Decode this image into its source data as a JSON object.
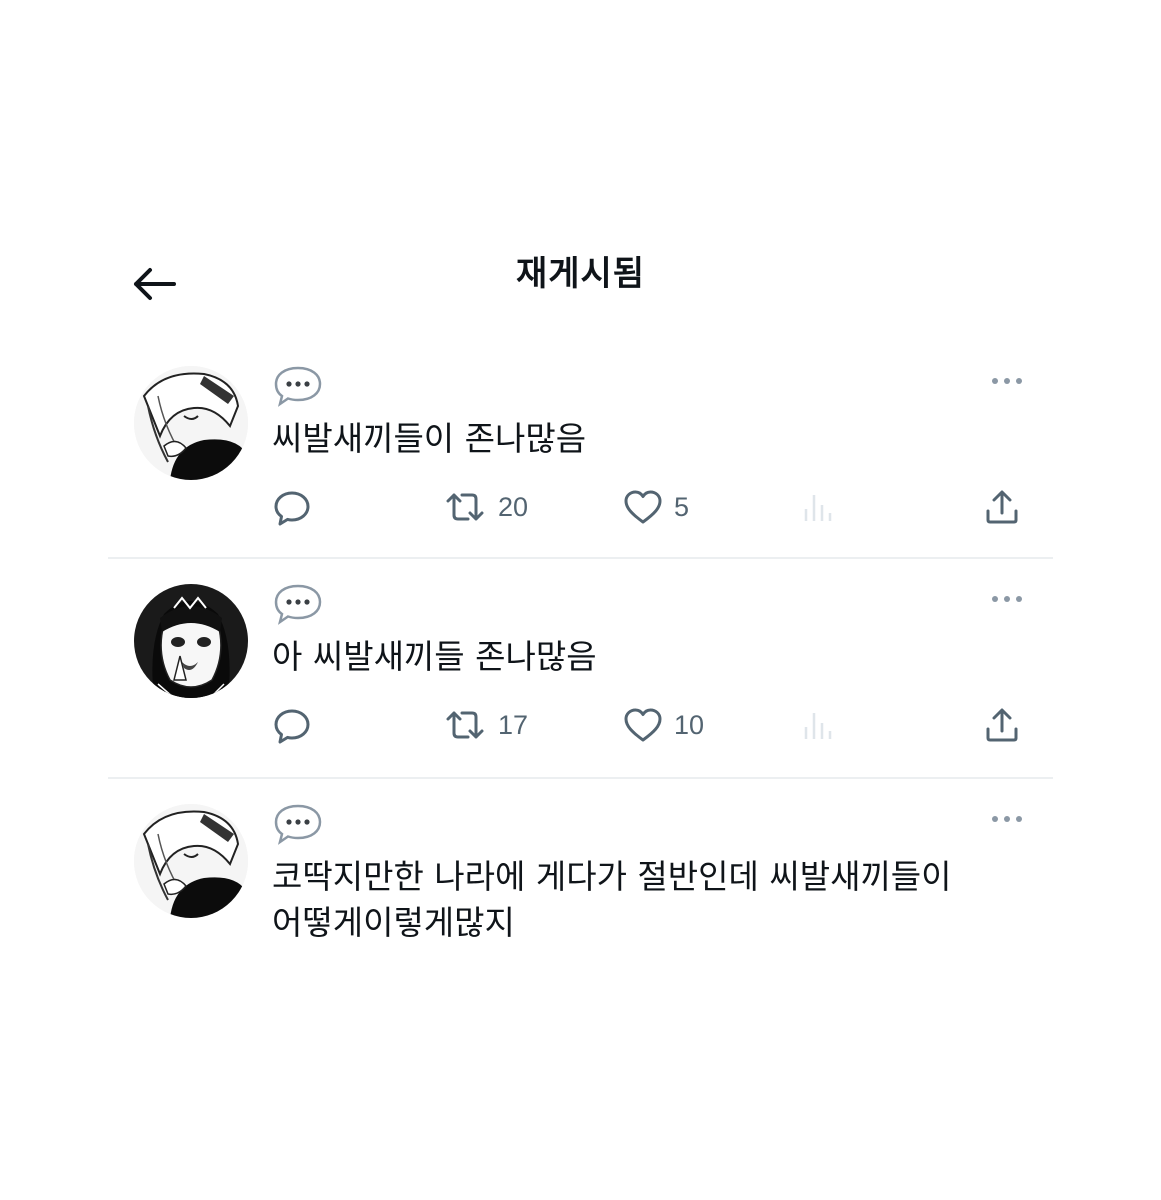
{
  "header": {
    "title": "재게시됨",
    "back_icon": "arrow-left-icon"
  },
  "posts": [
    {
      "avatar": "anime-avatar-1",
      "text": "씨발새끼들이 존나많음",
      "retweets": "20",
      "likes": "5"
    },
    {
      "avatar": "anime-avatar-2",
      "text": "아 씨발새끼들 존나많음",
      "retweets": "17",
      "likes": "10"
    },
    {
      "avatar": "anime-avatar-1",
      "text": "코딱지만한 나라에 게다가 절반인데 씨발새끼들이\n어떻게이렇게많지"
    }
  ],
  "colors": {
    "text": "#0f1419",
    "secondary": "#536471",
    "divider": "#eceff1",
    "muted_icon": "#cfd9de"
  }
}
